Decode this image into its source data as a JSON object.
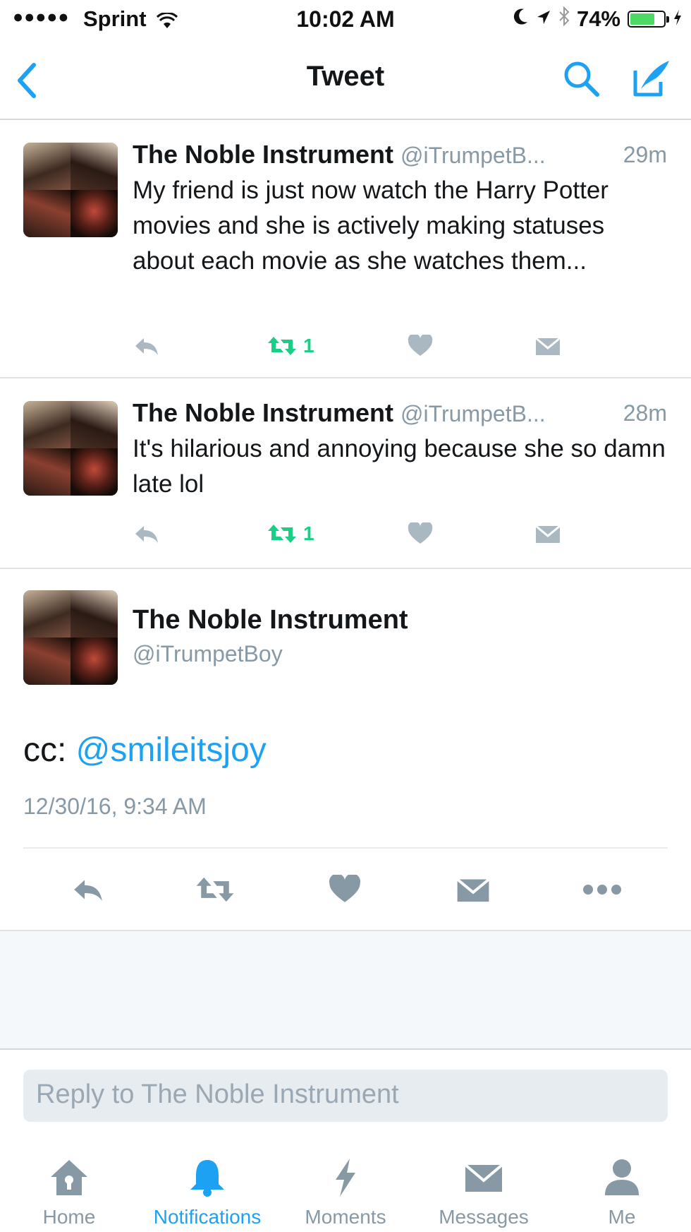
{
  "status_bar": {
    "signal": "●●●●●",
    "carrier": "Sprint",
    "time": "10:02 AM",
    "battery": "74%",
    "battery_level": 0.74
  },
  "nav": {
    "title": "Tweet"
  },
  "tweets": [
    {
      "name": "The Noble Instrument",
      "handle": "@iTrumpetB...",
      "time": "29m",
      "text": "My friend is just now watch the Harry Potter movies and she is actively making statuses about each movie as she watches them...",
      "retweets": "1"
    },
    {
      "name": "The Noble Instrument",
      "handle": "@iTrumpetB...",
      "time": "28m",
      "text": "It's hilarious and annoying because she so damn late lol",
      "retweets": "1"
    }
  ],
  "main_tweet": {
    "name": "The Noble Instrument",
    "handle": "@iTrumpetBoy",
    "text_prefix": "cc: ",
    "mention": "@smileitsjoy",
    "date": "12/30/16, 9:34 AM"
  },
  "reply": {
    "placeholder": "Reply to The Noble Instrument"
  },
  "tabs": [
    {
      "label": "Home",
      "icon": "home-icon"
    },
    {
      "label": "Notifications",
      "icon": "bell-icon",
      "active": true
    },
    {
      "label": "Moments",
      "icon": "lightning-icon"
    },
    {
      "label": "Messages",
      "icon": "envelope-icon"
    },
    {
      "label": "Me",
      "icon": "person-icon"
    }
  ],
  "colors": {
    "accent": "#1da1f2",
    "retweet": "#19cf86",
    "muted": "#8899a6",
    "battery": "#4cd964"
  }
}
